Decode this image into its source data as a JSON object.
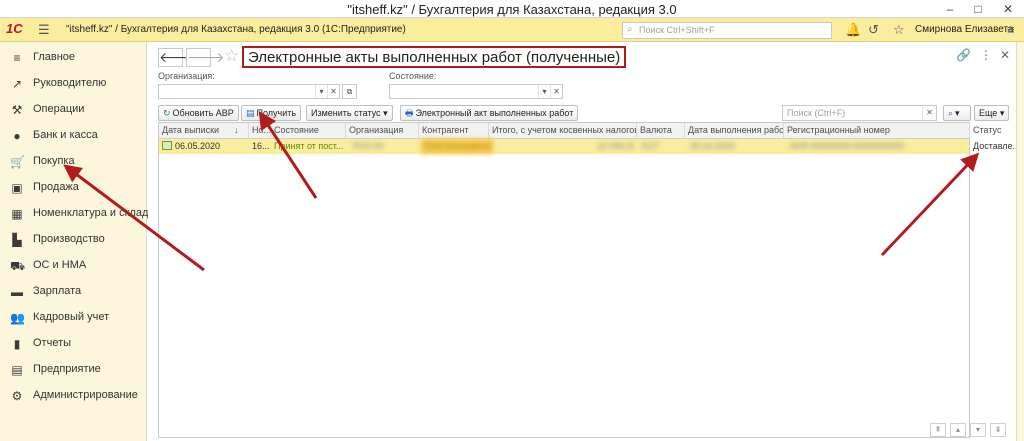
{
  "window": {
    "title": "\"itsheff.kz\" / Бухгалтерия для Казахстана, редакция 3.0",
    "minimize": "–",
    "maximize": "□",
    "close": "✕"
  },
  "topbar": {
    "logo": "1С",
    "app_title": "\"itsheff.kz\" / Бухгалтерия для Казахстана, редакция 3.0  (1С:Предприятие)",
    "search_placeholder": "Поиск Ctrl+Shift+F",
    "user_name": "Смирнова Елизавета"
  },
  "sidebar": {
    "items": [
      {
        "label": "Главное",
        "icon": "≡"
      },
      {
        "label": "Руководителю",
        "icon": "↗"
      },
      {
        "label": "Операции",
        "icon": "⚒"
      },
      {
        "label": "Банк и касса",
        "icon": "●"
      },
      {
        "label": "Покупка",
        "icon": "🛒"
      },
      {
        "label": "Продажа",
        "icon": "▣"
      },
      {
        "label": "Номенклатура и склад",
        "icon": "▦"
      },
      {
        "label": "Производство",
        "icon": "▙"
      },
      {
        "label": "ОС и НМА",
        "icon": "⛟"
      },
      {
        "label": "Зарплата",
        "icon": "▬"
      },
      {
        "label": "Кадровый учет",
        "icon": "👥"
      },
      {
        "label": "Отчеты",
        "icon": "▮"
      },
      {
        "label": "Предприятие",
        "icon": "▤"
      },
      {
        "label": "Администрирование",
        "icon": "⚙"
      }
    ]
  },
  "main": {
    "back": "🡐",
    "forward": "🡒",
    "title": "Электронные акты выполненных работ (полученные)",
    "filters": {
      "org_label": "Организация:",
      "state_label": "Состояние:"
    },
    "buttons": {
      "refresh": "Обновить АВР",
      "receive": "Получить",
      "change_status": "Изменить статус",
      "electronic_act": "Электронный акт выполненных работ",
      "more": "Еще"
    },
    "search_placeholder": "Поиск (Ctrl+F)",
    "table": {
      "columns": [
        "Дата выписки",
        "Но...",
        "Состояние",
        "Организация",
        "Контрагент",
        "Итого, с учетом косвенных налогов",
        "Валюта",
        "Дата выполнения работ",
        "Регистрационный номер",
        "Статус"
      ],
      "rows": [
        {
          "date": "06.05.2020",
          "num": "16...",
          "state": "Принят от пост...",
          "org": "ТОО Ит",
          "contractor": "ТОО Контрагент",
          "total": "10 000,00",
          "currency": "KZT",
          "work_date": "30.04.2020",
          "reg_number": "AVR-00000000-0000000000",
          "status": "Доставле..."
        }
      ]
    }
  },
  "colors": {
    "accent_yellow": "#fbed9e",
    "sidebar_bg": "#fbf6dc",
    "title_border": "#b01c1c",
    "arrow": "#b01c1c"
  }
}
